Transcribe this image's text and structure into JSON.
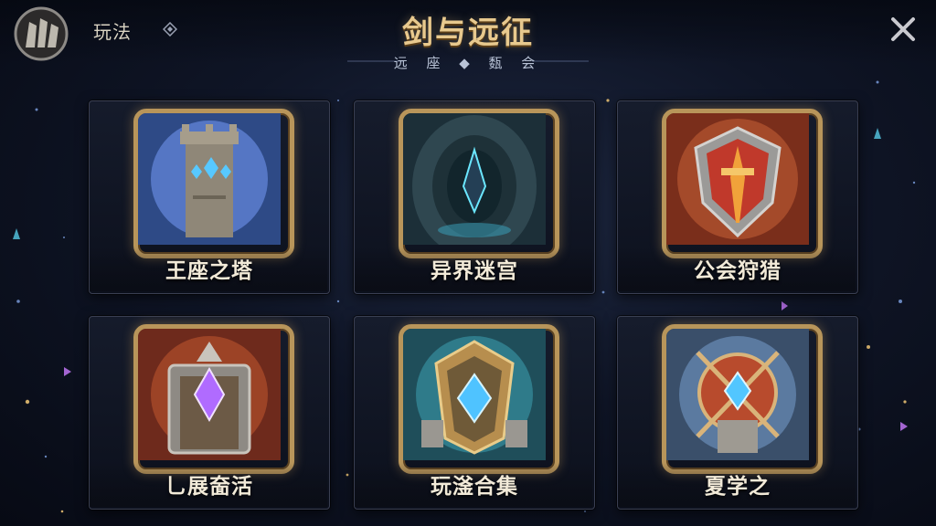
{
  "header": {
    "nav_label": "玩法",
    "title": "剑与远征",
    "subtitle": "远 座 ◆ 瓾 会"
  },
  "icons": {
    "logo": "guild-shield-logo-icon",
    "nav": "diamond-icon",
    "close": "close-icon"
  },
  "cards": [
    {
      "label": "王座之塔",
      "icon": "tower-icon"
    },
    {
      "label": "异界迷宫",
      "icon": "crystal-portal-icon"
    },
    {
      "label": "公会狩猎",
      "icon": "sword-shield-icon"
    },
    {
      "label": "乚展奤活",
      "icon": "crystal-gate-icon"
    },
    {
      "label": "玩滏合集",
      "icon": "blue-gem-armor-icon"
    },
    {
      "label": "夏学之",
      "icon": "knight-crossbow-icon"
    }
  ],
  "colors": {
    "gold_frame": "#b8955a",
    "title_gold": "#e8c98e",
    "background": "#0f1526"
  }
}
